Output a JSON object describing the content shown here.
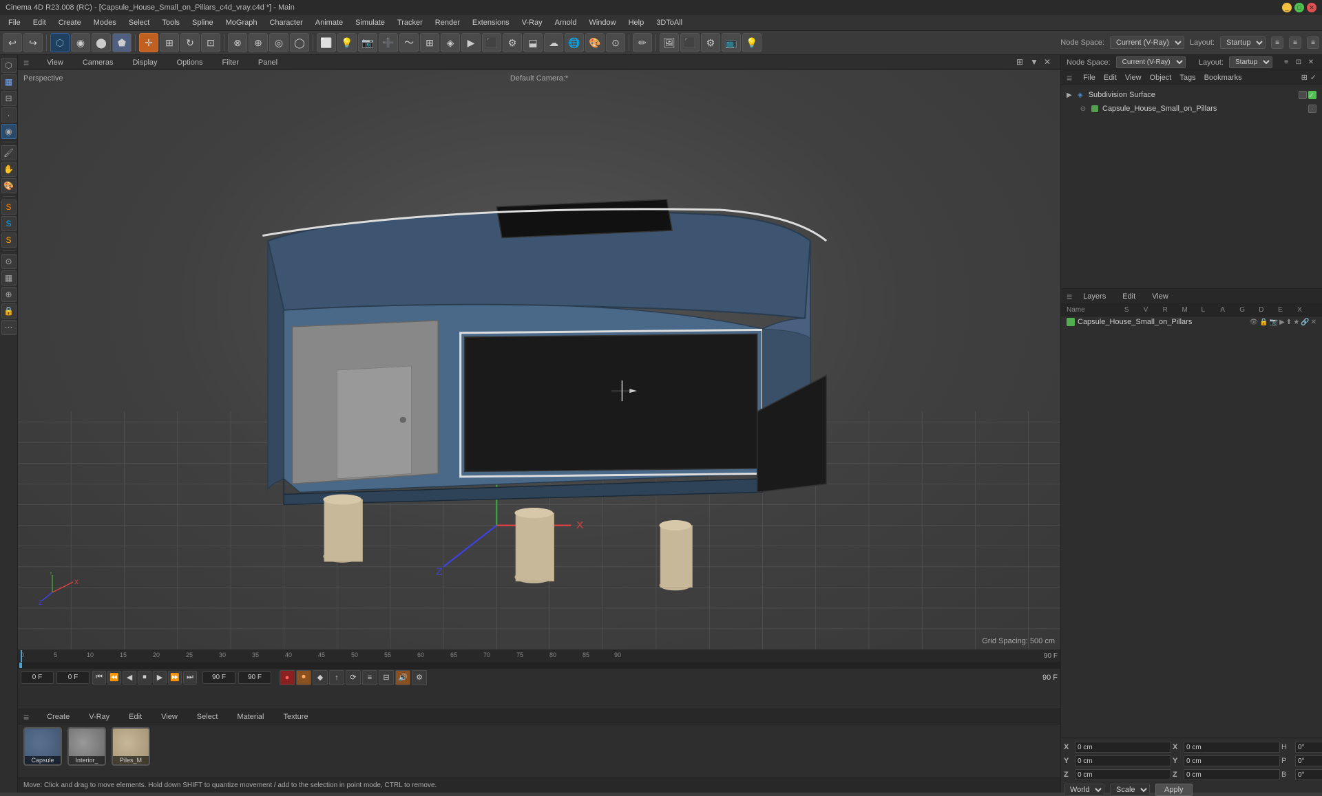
{
  "titlebar": {
    "title": "Cinema 4D R23.008 (RC) - [Capsule_House_Small_on_Pillars_c4d_vray.c4d *] - Main",
    "controls": [
      "_",
      "□",
      "✕"
    ]
  },
  "menubar": {
    "items": [
      "File",
      "Edit",
      "Create",
      "Modes",
      "Select",
      "Tools",
      "Spline",
      "MoGraph",
      "Character",
      "Animate",
      "Simulate",
      "Tracker",
      "Render",
      "Extensions",
      "V-Ray",
      "Arnold",
      "Window",
      "Help",
      "3DToAll"
    ]
  },
  "toolbar_right": {
    "node_space_label": "Node Space:",
    "node_space_value": "Current (V-Ray)",
    "layout_label": "Layout:",
    "layout_value": "Startup"
  },
  "viewport": {
    "perspective_label": "Perspective",
    "camera_label": "Default Camera:*",
    "grid_spacing": "Grid Spacing: 500 cm",
    "menus": [
      "View",
      "Cameras",
      "Display",
      "Options",
      "Filter",
      "Panel"
    ]
  },
  "timeline": {
    "ruler_marks": [
      "0",
      "5",
      "10",
      "15",
      "20",
      "25",
      "30",
      "35",
      "40",
      "45",
      "50",
      "55",
      "60",
      "65",
      "70",
      "75",
      "80",
      "85",
      "90"
    ],
    "current_frame": "0 F",
    "start_frame": "0 F",
    "end_frame": "90 F",
    "end_frame2": "90 F",
    "total_frames": "90 F"
  },
  "material_bar": {
    "menus": [
      "Create",
      "V-Ray",
      "Edit",
      "View",
      "Select",
      "Material",
      "Texture"
    ],
    "materials": [
      {
        "name": "Capsule",
        "color": "#4a6080"
      },
      {
        "name": "Interior_",
        "color": "#888888"
      },
      {
        "name": "Piles_M",
        "color": "#aaa080"
      }
    ]
  },
  "statusbar": {
    "text": "Move: Click and drag to move elements. Hold down SHIFT to quantize movement / add to the selection in point mode, CTRL to remove."
  },
  "object_manager": {
    "menus": [
      "File",
      "Edit",
      "View",
      "Object",
      "Tags",
      "Bookmarks"
    ],
    "objects": [
      {
        "name": "Subdivision Surface",
        "level": 0,
        "icon": "◈",
        "has_tag": true
      },
      {
        "name": "Capsule_House_Small_on_Pillars",
        "level": 1,
        "icon": "◉",
        "color": "#50a050"
      }
    ]
  },
  "layers_panel": {
    "menus": [
      "Layers",
      "Edit",
      "View"
    ],
    "columns": [
      "Name",
      "S",
      "V",
      "R",
      "M",
      "L",
      "A",
      "G",
      "D",
      "E",
      "X"
    ],
    "layers": [
      {
        "name": "Capsule_House_Small_on_Pillars",
        "color": "#50b050"
      }
    ]
  },
  "coords": {
    "x_pos": "0 cm",
    "y_pos": "0 cm",
    "z_pos": "0 cm",
    "x_rot": "0 cm",
    "y_rot": "0 cm",
    "z_rot": "0 cm",
    "h": "0°",
    "p": "0°",
    "b": "0°",
    "size_label_h": "H",
    "size_label_p": "P",
    "size_label_b": "B",
    "coord_mode": "World",
    "transform_mode": "Scale",
    "apply_label": "Apply",
    "x_label": "X",
    "y_label": "Y",
    "z_label": "Z"
  }
}
